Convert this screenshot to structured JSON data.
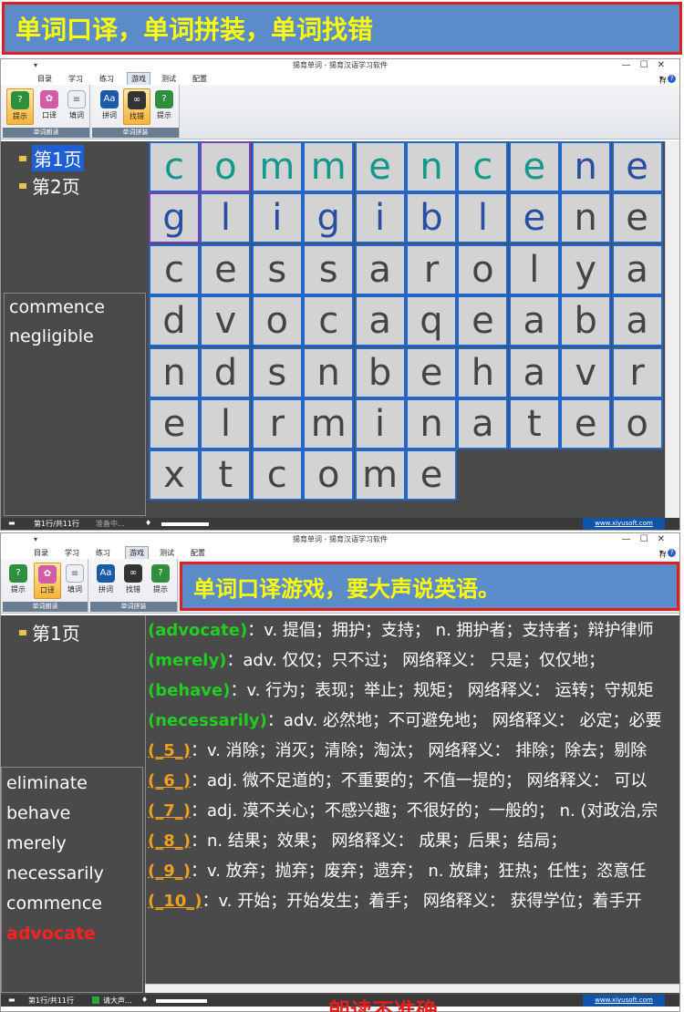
{
  "banner_top": "单词口译，单词拼装，单词找错",
  "win1": {
    "title": "锡育单词 - 锡育汉语学习软件",
    "tabs": [
      "目录",
      "学习",
      "练习",
      "游戏",
      "测试",
      "配置"
    ],
    "style_label": "样式",
    "groups": [
      {
        "label": "单词朗读",
        "buttons": [
          "提示",
          "口译",
          "填词"
        ]
      },
      {
        "label": "单词拼装",
        "buttons": [
          "拼词",
          "找错",
          "提示"
        ]
      }
    ],
    "pages": [
      "第1页",
      "第2页"
    ],
    "words": [
      "commence",
      "negligible"
    ],
    "grid": [
      [
        "c",
        "o",
        "m",
        "m",
        "e",
        "n",
        "c",
        "e",
        "n",
        "e"
      ],
      [
        "g",
        "l",
        "i",
        "g",
        "i",
        "b",
        "l",
        "e",
        "n",
        "e"
      ],
      [
        "c",
        "e",
        "s",
        "s",
        "a",
        "r",
        "o",
        "l",
        "y",
        "a"
      ],
      [
        "d",
        "v",
        "o",
        "c",
        "a",
        "q",
        "e",
        "a",
        "b",
        "a"
      ],
      [
        "n",
        "d",
        "s",
        "n",
        "b",
        "e",
        "h",
        "a",
        "v",
        "r"
      ],
      [
        "e",
        "l",
        "r",
        "m",
        "i",
        "n",
        "a",
        "t",
        "e",
        "o"
      ],
      [
        "x",
        "t",
        "c",
        "o",
        "m",
        "e"
      ]
    ],
    "status": {
      "pos": "第1行/共11行",
      "ready": "准备中...",
      "site": "www.xiyusoft.com"
    }
  },
  "win2": {
    "title": "锡育单词 - 锡育汉语学习软件",
    "tabs": [
      "目录",
      "学习",
      "练习",
      "游戏",
      "测试",
      "配置"
    ],
    "style_label": "样式",
    "groups": [
      {
        "label": "单词朗读",
        "buttons": [
          "提示",
          "口译",
          "填词"
        ]
      },
      {
        "label": "单词拼装",
        "buttons": [
          "拼词",
          "找错",
          "提示"
        ]
      }
    ],
    "banner": "单词口译游戏，要大声说英语。",
    "pages": [
      "第1页"
    ],
    "words": [
      "eliminate",
      "behave",
      "merely",
      "necessarily",
      "commence",
      "advocate"
    ],
    "defs": [
      {
        "head": "(advocate)",
        "text": "：v. 提倡；拥护；支持； n. 拥护者；支持者；辩护律师"
      },
      {
        "head": "(merely)",
        "text": "：adv. 仅仅；只不过； 网络释义： 只是；仅仅地；"
      },
      {
        "head": "(behave)",
        "text": "：v. 行为；表现；举止；规矩； 网络释义： 运转；守规矩"
      },
      {
        "head": "(necessarily)",
        "text": "：adv. 必然地；不可避免地； 网络释义： 必定；必要"
      },
      {
        "blank": "(_5_)",
        "text": "：v. 消除；消灭；清除；淘汰； 网络释义： 排除；除去；剔除"
      },
      {
        "blank": "(_6_)",
        "text": "：adj. 微不足道的；不重要的；不值一提的； 网络释义： 可以"
      },
      {
        "blank": "(_7_)",
        "text": "：adj. 漠不关心；不感兴趣；不很好的；一般的； n. (对政治,宗"
      },
      {
        "blank": "(_8_)",
        "text": "：n. 结果；效果； 网络释义： 成果；后果；结局；"
      },
      {
        "blank": "(_9_)",
        "text": "：v. 放弃；抛弃；废弃；遗弃； n. 放肆；狂热；任性；恣意任"
      },
      {
        "blank": "(_10_)",
        "text": "：v. 开始；开始发生；着手； 网络释义： 获得学位；着手开"
      }
    ],
    "status": {
      "pos": "第1行/共11行",
      "ready": "请大声...",
      "site": "www.xiyusoft.com"
    },
    "bottom_cut": "朗读不准确"
  }
}
